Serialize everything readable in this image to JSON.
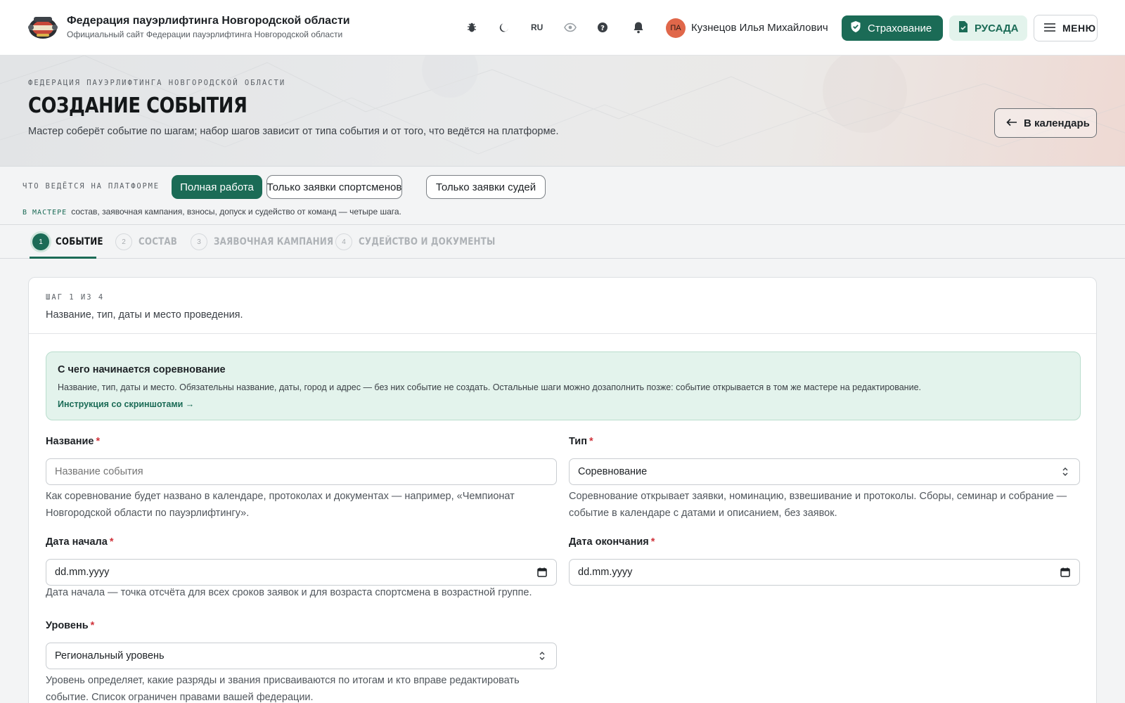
{
  "header": {
    "brand_title": "Федерация пауэрлифтинга Новгородской области",
    "brand_subtitle": "Официальный сайт Федерации пауэрлифтинга Новгородской области",
    "icons": [
      "bug-icon",
      "moon-icon",
      "eye-icon",
      "help-icon",
      "bell-icon"
    ],
    "language": "RU",
    "user": {
      "initials": "ПА",
      "name": "Кузнецов Илья Михайлович",
      "avatar_color": "#e0674a"
    },
    "insurance_label": "Страхование",
    "rusada_label": "РУСАДА",
    "menu_label": "МЕНЮ"
  },
  "hero": {
    "eyebrow": "ФЕДЕРАЦИЯ ПАУЭРЛИФТИНГА НОВГОРОДСКОЙ ОБЛАСТИ",
    "title": "СОЗДАНИЕ СОБЫТИЯ",
    "description": "Мастер соберёт событие по шагам; набор шагов зависит от типа события и от того, что ведётся на платформе.",
    "back_label": "В календарь"
  },
  "platform": {
    "label": "ЧТО ВЕДЁТСЯ НА ПЛАТФОРМЕ",
    "options": [
      {
        "label": "Полная работа",
        "selected": true
      },
      {
        "label": "Только заявки спортсменов",
        "selected": false
      },
      {
        "label": "Только заявки судей",
        "selected": false
      }
    ],
    "note_key": "В МАСТЕРЕ",
    "note_text": "состав, заявочная кампания, взносы, допуск и судейство от команд — четыре шага."
  },
  "steps": [
    {
      "num": "1",
      "label": "СОБЫТИЕ",
      "active": true
    },
    {
      "num": "2",
      "label": "СОСТАВ",
      "active": false
    },
    {
      "num": "3",
      "label": "ЗАЯВОЧНАЯ КАМПАНИЯ",
      "active": false
    },
    {
      "num": "4",
      "label": "СУДЕЙСТВО И ДОКУМЕНТЫ",
      "active": false
    }
  ],
  "card": {
    "step_of": "ШАГ 1 ИЗ 4",
    "subtitle": "Название, тип, даты и место проведения.",
    "info": {
      "title": "С чего начинается соревнование",
      "text": "Название, тип, даты и место. Обязательны название, даты, город и адрес — без них событие не создать. Остальные шаги можно дозаполнить позже: событие открывается в том же мастере на редактирование.",
      "link": "Инструкция со скриншотами →"
    },
    "fields": {
      "name": {
        "label": "Название",
        "required_mark": "*",
        "placeholder": "Название события",
        "hint": "Как соревнование будет названо в календаре, протоколах и документах — например, «Чемпионат Новгородской области по пауэрлифтингу»."
      },
      "type": {
        "label": "Тип",
        "required_mark": "*",
        "value": "Соревнование",
        "hint": "Соревнование открывает заявки, номинацию, взвешивание и протоколы. Сборы, семинар и собрание — событие в календаре с датами и описанием, без заявок."
      },
      "start_date": {
        "label": "Дата начала",
        "required_mark": "*",
        "value": "dd.mm.yyyy",
        "hint": "Дата начала — точка отсчёта для всех сроков заявок и для возраста спортсмена в возрастной группе."
      },
      "end_date": {
        "label": "Дата окончания",
        "required_mark": "*",
        "value": "dd.mm.yyyy"
      },
      "level": {
        "label": "Уровень",
        "required_mark": "*",
        "value": "Региональный уровень",
        "hint": "Уровень определяет, какие разряды и звания присваиваются по итогам и кто вправе редактировать событие. Список ограничен правами вашей федерации."
      }
    }
  },
  "colors": {
    "accent": "#1b6b56",
    "accent_light": "#e3f3ec",
    "required": "#d0343c"
  }
}
